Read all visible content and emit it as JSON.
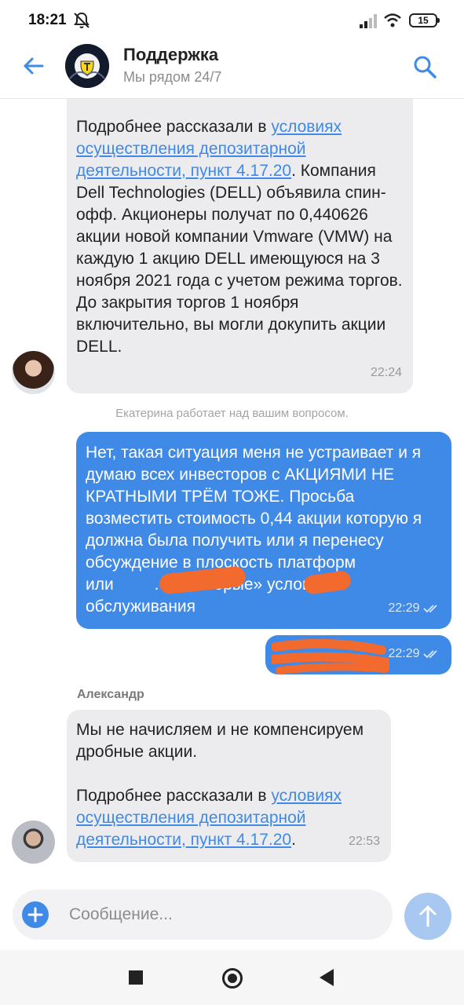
{
  "status_bar": {
    "time": "18:21",
    "battery": "15",
    "icons": [
      "mute-icon",
      "signal-icon",
      "wifi-icon",
      "battery-icon"
    ]
  },
  "header": {
    "title": "Поддержка",
    "subtitle": "Мы рядом 24/7",
    "icons": [
      "arrow-left-icon",
      "search-icon"
    ]
  },
  "messages": [
    {
      "direction": "incoming",
      "link_prefix": "Подробнее рассказали в ",
      "link_text": "условиях осуществления депозитарной деятельности, пункт 4.17.20",
      "link_suffix": ".",
      "body": "Компания Dell Technologies (DELL) объявила спин-офф. Акционеры получат по 0,440626 акции новой компании Vmware (VMW) на каждую 1 акцию DELL имеющуюся на 3 ноября 2021 года с учетом режима торгов. До закрытия торгов 1 ноября включительно, вы могли докупить акции DELL.",
      "time": "22:24"
    },
    {
      "direction": "system",
      "text": "Екатерина работает над вашим вопросом."
    },
    {
      "direction": "outgoing",
      "text_before": "Нет, такая ситуация меня не устраивает и я думаю всех инвесторов с АКЦИЯМИ НЕ КРАТНЫМИ ТРЁМ ТОЖЕ. Просьба возместить стоимость 0,44 акции которую я должна была получить или я перенесу обсуждение в плоскость платформ ",
      "text_middle": " или ",
      "text_after": ". Это «серые» условия обслуживания",
      "time": "22:29"
    },
    {
      "direction": "outgoing",
      "time": "22:29"
    },
    {
      "direction": "incoming",
      "sender": "Александр",
      "body": "Мы не начисляем и не компенсируем дробные акции.",
      "link_prefix": "Подробнее рассказали в ",
      "link_text": "условиях осуществления депозитарной деятельности, пункт 4.17.20",
      "link_suffix": ".",
      "time": "22:53"
    }
  ],
  "input": {
    "placeholder": "Сообщение..."
  },
  "colors": {
    "accent": "#3f8ae7",
    "incoming_bubble": "#ececee",
    "redaction": "#f26a2e"
  }
}
